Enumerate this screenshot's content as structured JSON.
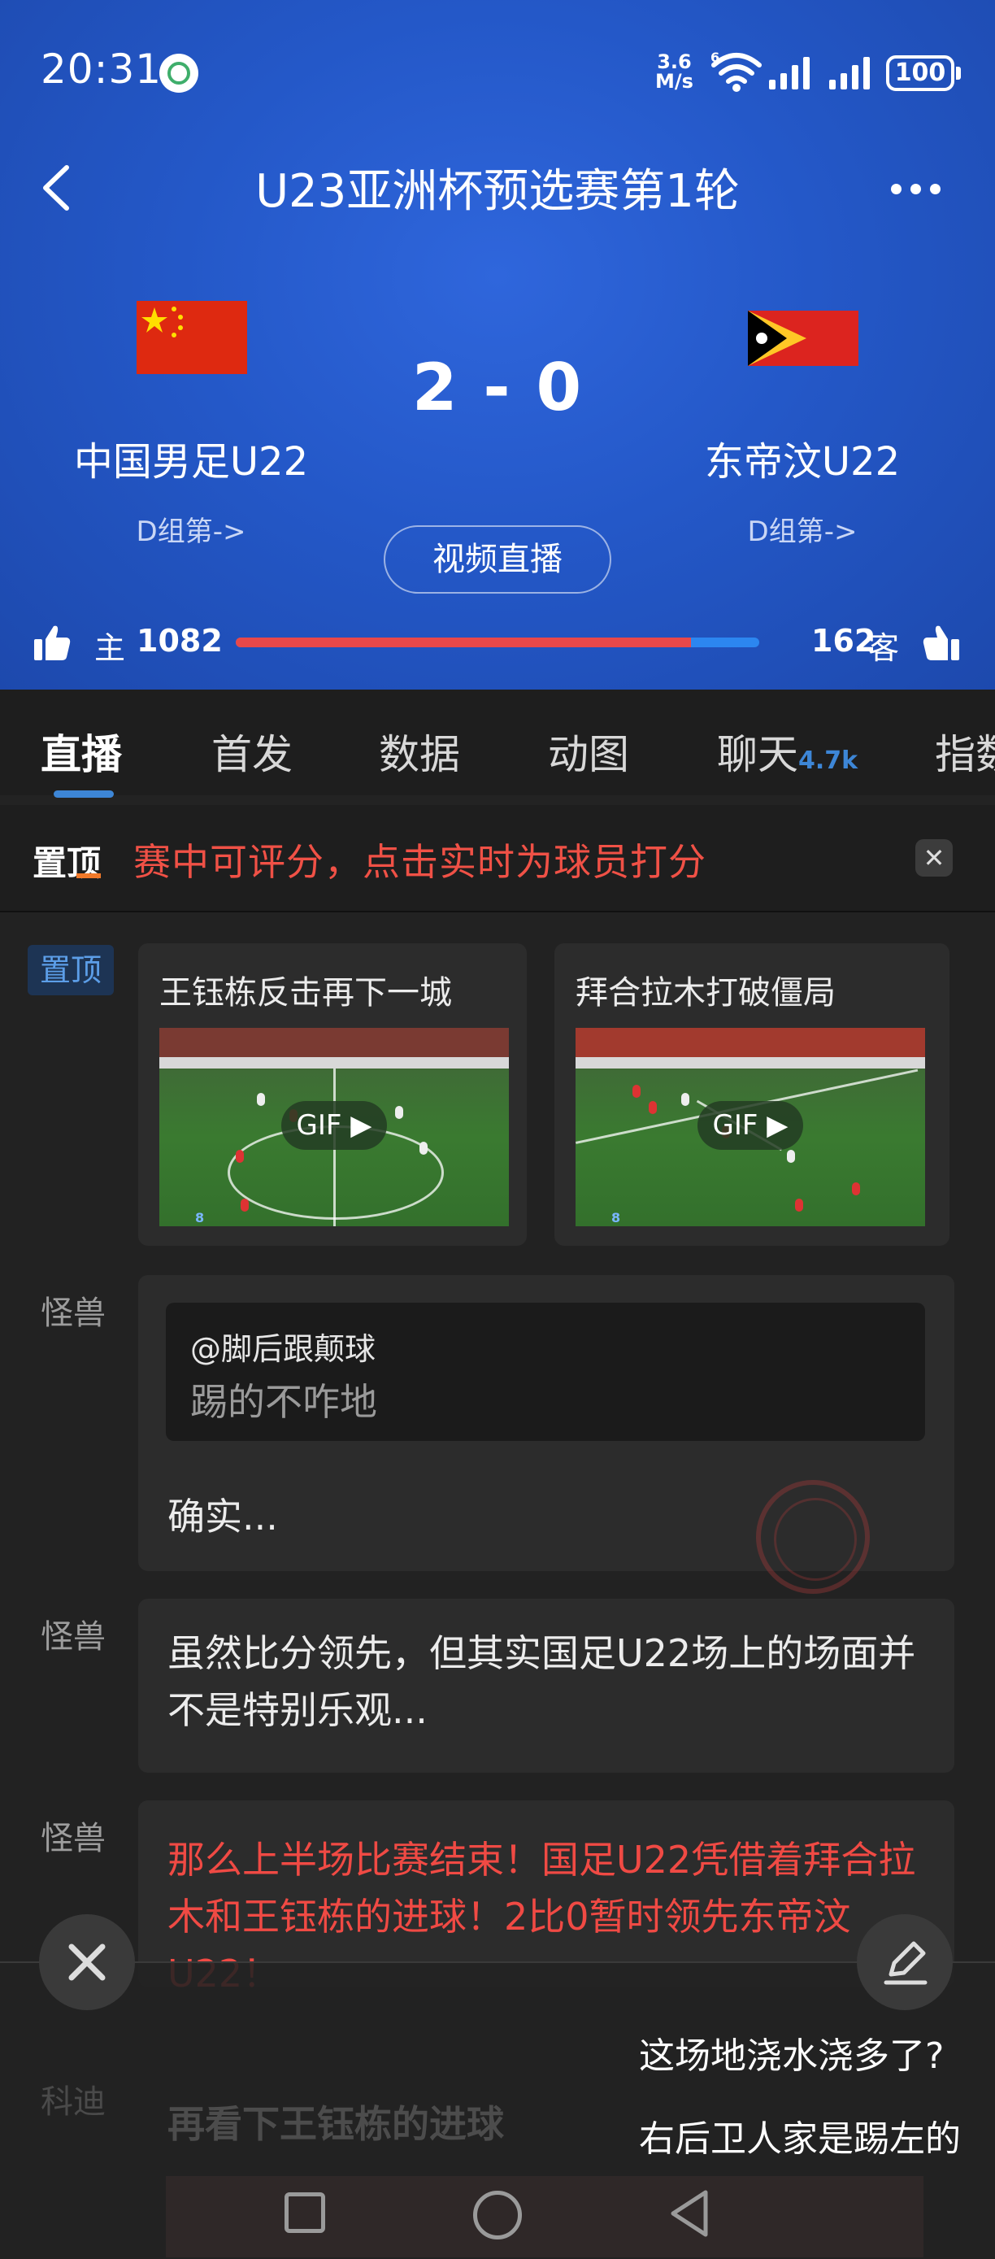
{
  "status_bar": {
    "time": "20:31",
    "net_speed_value": "3.6",
    "net_speed_unit": "M/s",
    "wifi_badge": "6",
    "battery": "100"
  },
  "header": {
    "title": "U23亚洲杯预选赛第1轮"
  },
  "match": {
    "home": {
      "name": "中国男足U22",
      "group": "D组第->"
    },
    "away": {
      "name": "东帝汶U22",
      "group": "D组第->"
    },
    "score": "2 - 0",
    "live_button": "视频直播",
    "support": {
      "home_label": "主",
      "home_votes": "1082",
      "away_votes": "162",
      "away_label": "客",
      "home_share": 0.87,
      "home_color": "#e8484a",
      "away_color": "#2c86f0"
    }
  },
  "tabs": [
    {
      "label": "直播",
      "active": true
    },
    {
      "label": "首发"
    },
    {
      "label": "数据"
    },
    {
      "label": "动图"
    },
    {
      "label": "聊天",
      "badge": "4.7k"
    },
    {
      "label": "指数"
    }
  ],
  "pinned_banner": {
    "badge": "置顶",
    "text": "赛中可评分，点击实时为球员打分",
    "close_icon": "close-icon"
  },
  "feed": [
    {
      "side": "置顶",
      "gifs": [
        {
          "title": "王钰栋反击再下一城",
          "badge": "GIF"
        },
        {
          "title": "拜合拉木打破僵局",
          "badge": "GIF"
        }
      ]
    },
    {
      "author": "怪兽",
      "quote_user": "@脚后跟颠球",
      "quote_text": "踢的不咋地",
      "text": "确实..."
    },
    {
      "author": "怪兽",
      "text": "虽然比分领先，但其实国足U22场上的场面并不是特别乐观..."
    },
    {
      "author": "怪兽",
      "text": "那么上半场比赛结束！国足U22凭借着拜合拉木和王钰栋的进球！2比0暂时领先东帝汶U22！",
      "color": "#f04a44"
    },
    {
      "author": "科迪",
      "text": "再看下王钰栋的进球"
    }
  ],
  "danmaku": [
    "这场地浇水浇多了?",
    "右后卫人家是踢左的"
  ]
}
